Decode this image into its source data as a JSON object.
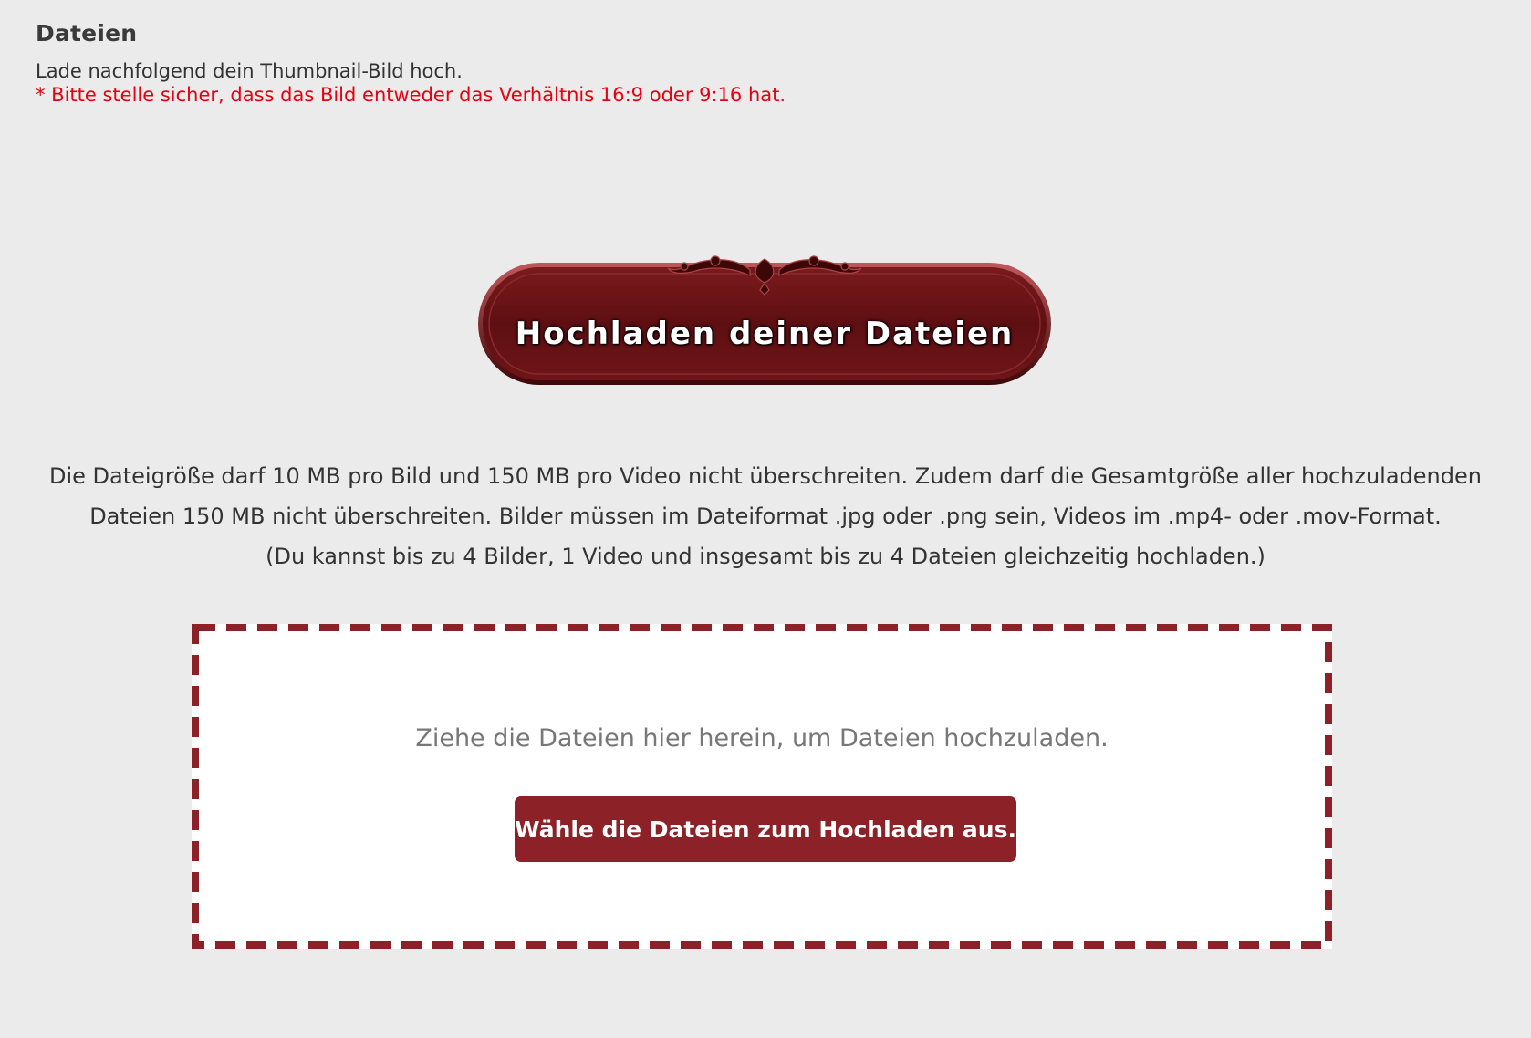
{
  "header": {
    "title": "Dateien",
    "description": "Lade nachfolgend dein Thumbnail-Bild hoch.",
    "note": "* Bitte stelle sicher, dass das Bild entweder das Verhältnis 16:9 oder 9:16 hat."
  },
  "banner": {
    "label": "Hochladen deiner Dateien",
    "icon": "ornament-icon"
  },
  "limits": {
    "line1": "Die Dateigröße darf 10 MB pro Bild und 150 MB pro Video nicht überschreiten. Zudem darf die Gesamtgröße aller hochzuladenden",
    "line2": "Dateien 150 MB nicht überschreiten. Bilder müssen im Dateiformat .jpg oder .png sein, Videos im .mp4- oder .mov-Format.",
    "line3": "(Du kannst bis zu 4 Bilder, 1 Video und insgesamt bis zu 4 Dateien gleichzeitig hochladen.)"
  },
  "dropzone": {
    "hint": "Ziehe die Dateien hier herein, um Dateien hochzuladen.",
    "button_label": "Wähle die Dateien zum Hochladen aus."
  },
  "colors": {
    "background": "#ebebeb",
    "accent": "#8c2227",
    "banner_dark": "#5e0f12",
    "note_red": "#e60012",
    "dropzone_border": "#8c2227"
  }
}
